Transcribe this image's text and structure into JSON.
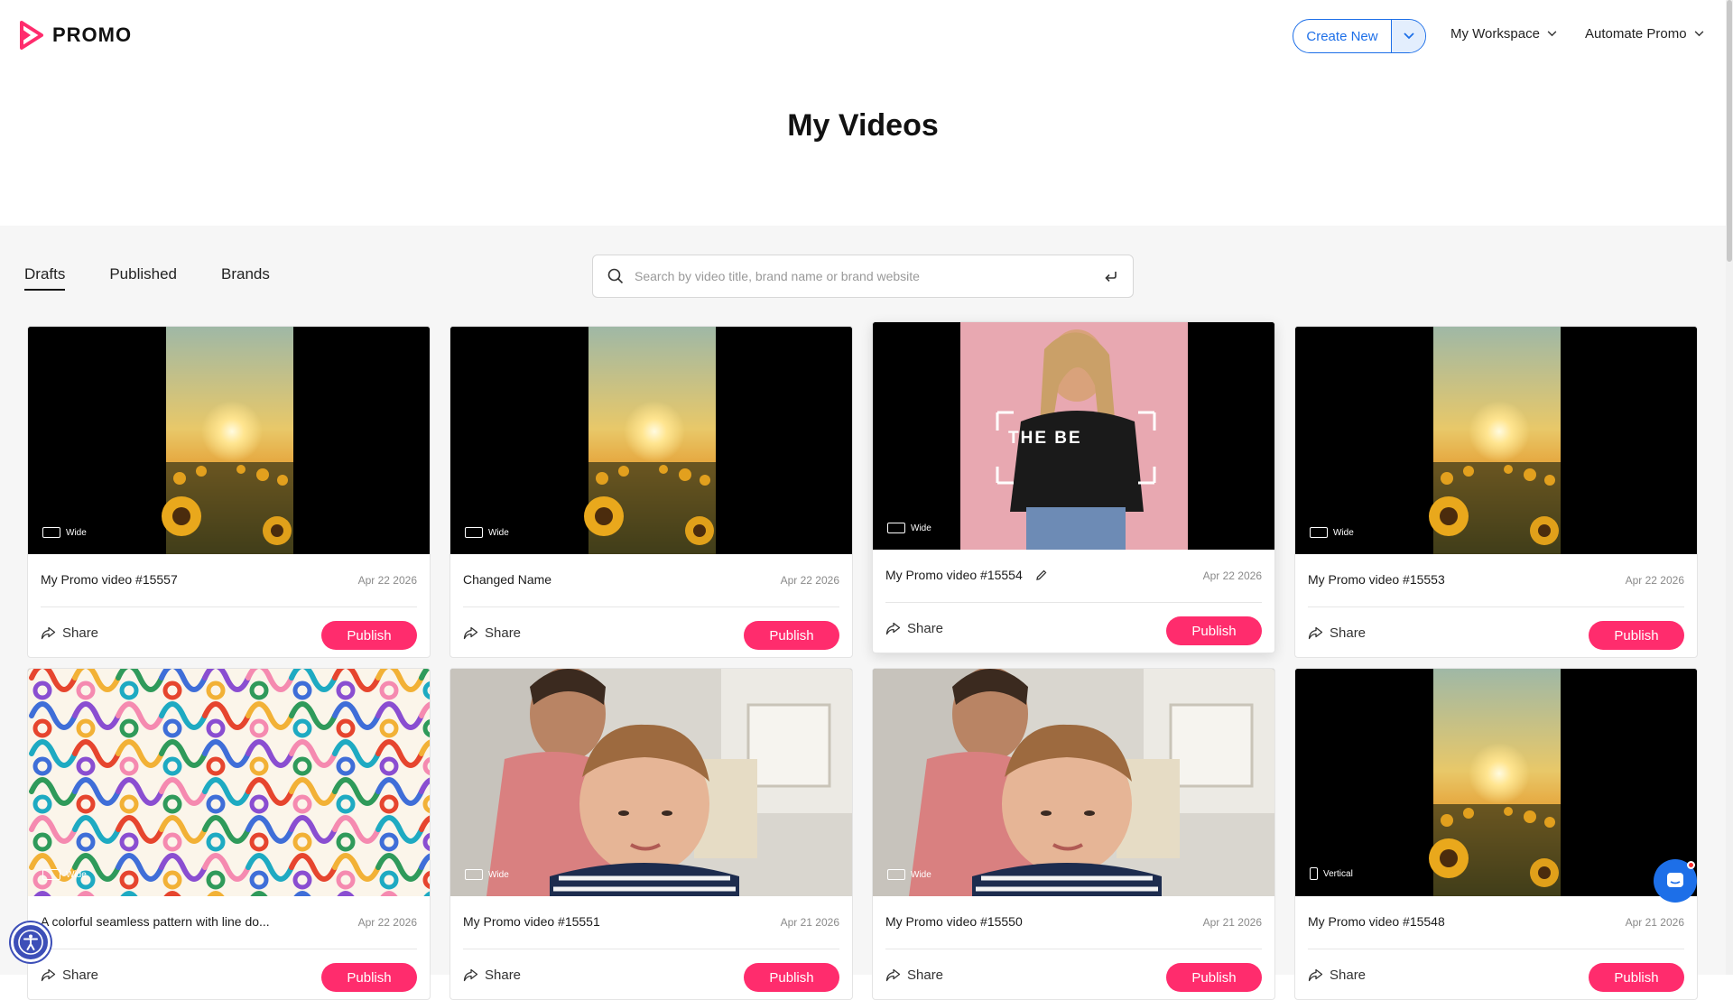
{
  "app": {
    "logo_text": "PROMO",
    "brand_color": "#ff2c6d",
    "accent_color": "#1d6fe8"
  },
  "header": {
    "create_new_label": "Create New",
    "workspace_label": "My Workspace",
    "automate_label": "Automate Promo"
  },
  "page": {
    "title": "My Videos"
  },
  "tabs": [
    {
      "label": "Drafts",
      "active": true
    },
    {
      "label": "Published",
      "active": false
    },
    {
      "label": "Brands",
      "active": false
    }
  ],
  "search": {
    "placeholder": "Search by video title, brand name or brand website"
  },
  "cards": [
    {
      "title": "My Promo video #15557",
      "date": "Apr 22 2026",
      "format": "Wide",
      "thumb": "sunflower",
      "share_label": "Share",
      "publish_label": "Publish"
    },
    {
      "title": "Changed Name",
      "date": "Apr 22 2026",
      "format": "Wide",
      "thumb": "sunflower",
      "share_label": "Share",
      "publish_label": "Publish"
    },
    {
      "title": "My Promo video #15554",
      "date": "Apr 22 2026",
      "format": "Wide",
      "thumb": "fashion",
      "overlay_text": "THE BE",
      "share_label": "Share",
      "publish_label": "Publish"
    },
    {
      "title": "My Promo video #15553",
      "date": "Apr 22 2026",
      "format": "Wide",
      "thumb": "sunflower",
      "share_label": "Share",
      "publish_label": "Publish"
    },
    {
      "title": "A colorful seamless pattern with line do...",
      "date": "Apr 22 2026",
      "format": "Wide",
      "thumb": "pattern",
      "share_label": "Share",
      "publish_label": "Publish"
    },
    {
      "title": "My Promo video #15551",
      "date": "Apr 21 2026",
      "format": "Wide",
      "thumb": "kid",
      "share_label": "Share",
      "publish_label": "Publish"
    },
    {
      "title": "My Promo video #15550",
      "date": "Apr 21 2026",
      "format": "Wide",
      "thumb": "kid",
      "share_label": "Share",
      "publish_label": "Publish"
    },
    {
      "title": "My Promo video #15548",
      "date": "Apr 21 2026",
      "format": "Vertical",
      "thumb": "sunflower",
      "share_label": "Share",
      "publish_label": "Publish"
    }
  ]
}
